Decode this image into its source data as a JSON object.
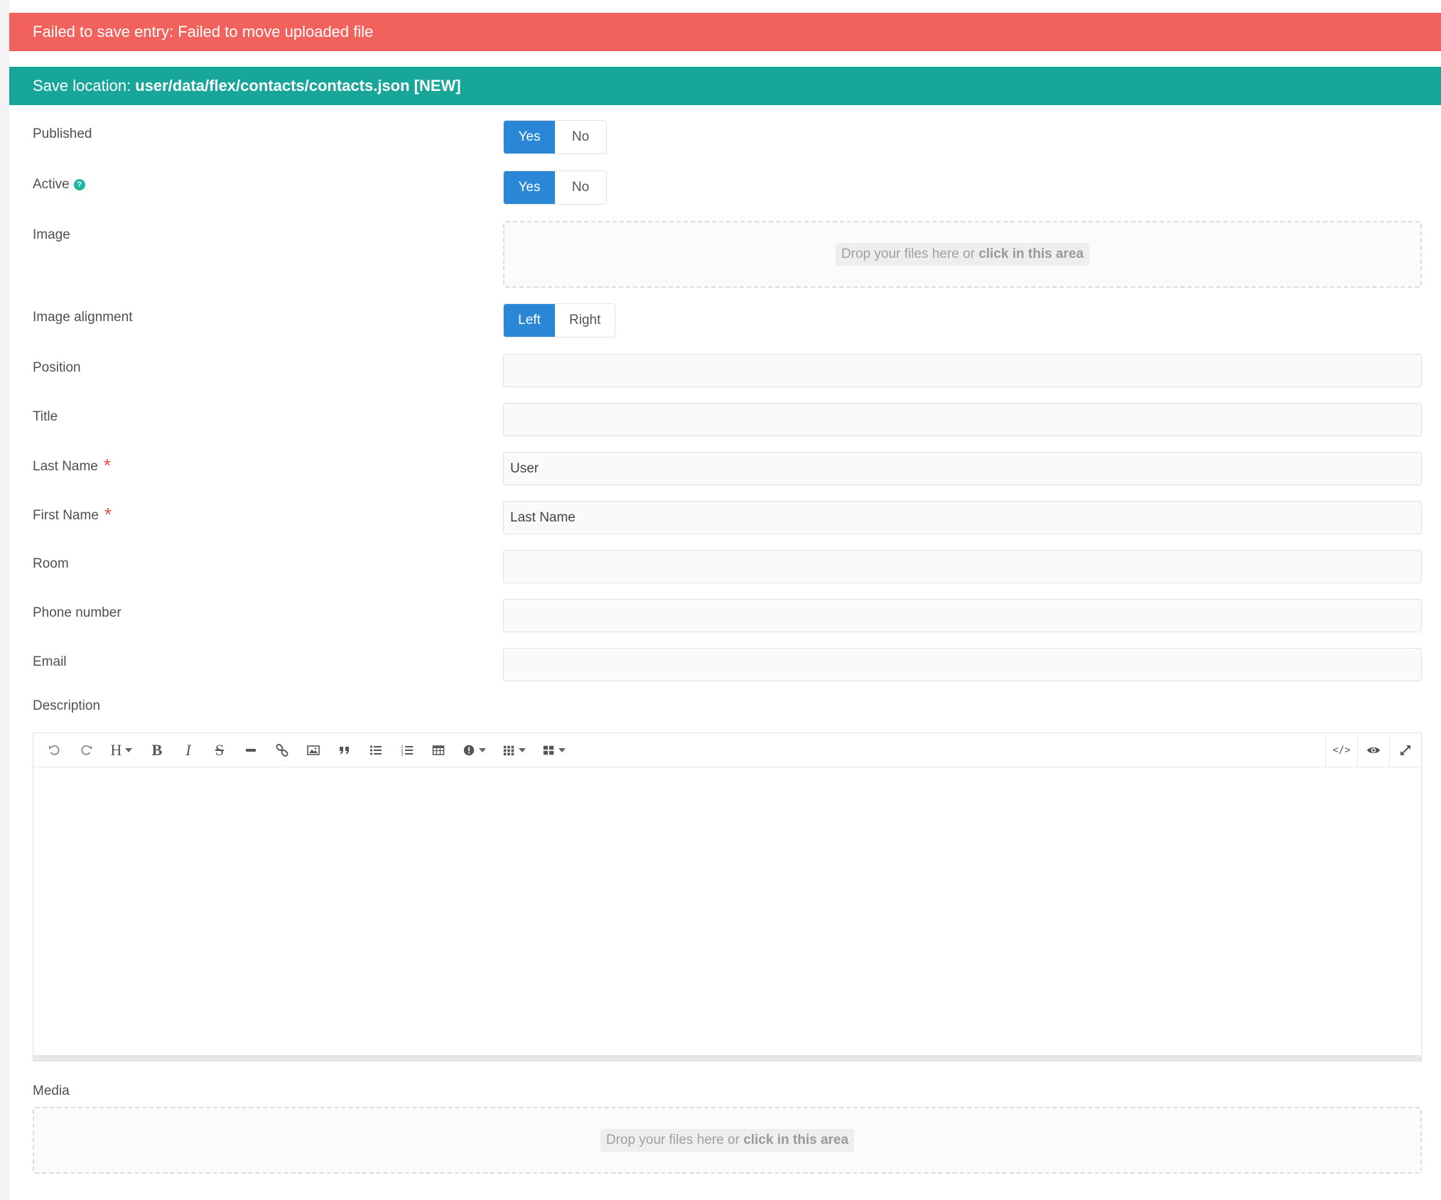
{
  "alert": {
    "text": "Failed to save entry: Failed to move uploaded file"
  },
  "notice": {
    "prefix": "Save location:",
    "path": "user/data/flex/contacts/contacts.json [NEW]"
  },
  "fields": {
    "published": {
      "label": "Published",
      "options": [
        "Yes",
        "No"
      ],
      "selected": "Yes"
    },
    "active": {
      "label": "Active",
      "help_icon": "question-circle-icon",
      "options": [
        "Yes",
        "No"
      ],
      "selected": "Yes"
    },
    "image": {
      "label": "Image",
      "drop_text": "Drop your files here or",
      "drop_link": "click in this area"
    },
    "image_alignment": {
      "label": "Image alignment",
      "options": [
        "Left",
        "Right"
      ],
      "selected": "Left"
    },
    "position": {
      "label": "Position",
      "value": ""
    },
    "title": {
      "label": "Title",
      "value": ""
    },
    "last_name": {
      "label": "Last Name",
      "required_mark": "*",
      "value": "User"
    },
    "first_name": {
      "label": "First Name",
      "required_mark": "*",
      "value": "Last Name"
    },
    "room": {
      "label": "Room",
      "value": ""
    },
    "phone_number": {
      "label": "Phone number",
      "value": ""
    },
    "email": {
      "label": "Email",
      "value": ""
    },
    "description": {
      "label": "Description",
      "toolbar": [
        "undo-icon",
        "redo-icon",
        "heading-icon",
        "bold-icon",
        "italic-icon",
        "strikethrough-icon",
        "horizontal-rule-icon",
        "link-icon",
        "image-icon",
        "quote-icon",
        "bullet-list-icon",
        "numbered-list-icon",
        "table-icon",
        "notice-icon",
        "grid-icon",
        "shortcodes-icon"
      ],
      "toolbar_right": [
        "code-view-icon",
        "preview-eye-icon",
        "fullscreen-icon"
      ],
      "heading_glyph": "H",
      "bold_glyph": "B",
      "italic_glyph": "I",
      "strike_glyph": "S",
      "code_glyph": "</>"
    },
    "media": {
      "label": "Media",
      "drop_text": "Drop your files here or",
      "drop_link": "click in this area"
    }
  },
  "colors": {
    "alert": "#f2625c",
    "notice": "#18a69a",
    "toggle_active": "#2a87d6",
    "required": "#e74c3c"
  }
}
